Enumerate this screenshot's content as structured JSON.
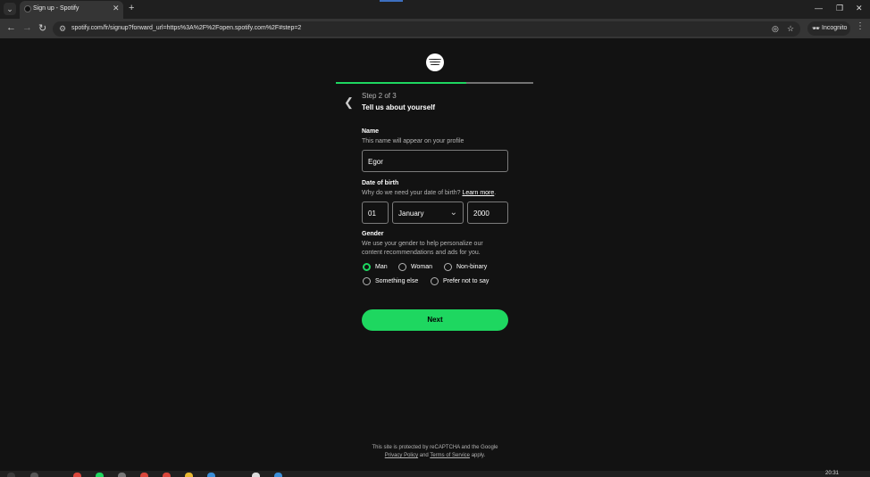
{
  "browser": {
    "tab_title": "Sign up - Spotify",
    "url": "spotify.com/fr/signup?forward_url=https%3A%2F%2Fopen.spotify.com%2F#step=2",
    "incognito_label": "Incognito"
  },
  "signup": {
    "progress_fraction": 0.66,
    "step_label": "Step 2 of 3",
    "step_title": "Tell us about yourself",
    "name": {
      "label": "Name",
      "hint": "This name will appear on your profile",
      "value": "Egor"
    },
    "dob": {
      "label": "Date of birth",
      "hint": "Why do we need your date of birth?",
      "learn_more": "Learn more",
      "hint_suffix": ".",
      "day": "01",
      "month": "January",
      "year": "2000"
    },
    "gender": {
      "label": "Gender",
      "hint_line1": "We use your gender to help personalize our",
      "hint_line2": "content recommendations and ads for you.",
      "options": [
        "Man",
        "Woman",
        "Non-binary",
        "Something else",
        "Prefer not to say"
      ],
      "selected": "Man"
    },
    "next_label": "Next"
  },
  "footer": {
    "line1": "This site is protected by reCAPTCHA and the Google",
    "privacy": "Privacy Policy",
    "and": "and",
    "terms": "Terms of Service",
    "apply": "apply."
  },
  "taskbar": {
    "clock": "20:31"
  },
  "colors": {
    "accent": "#1ed760",
    "background": "#121212"
  }
}
